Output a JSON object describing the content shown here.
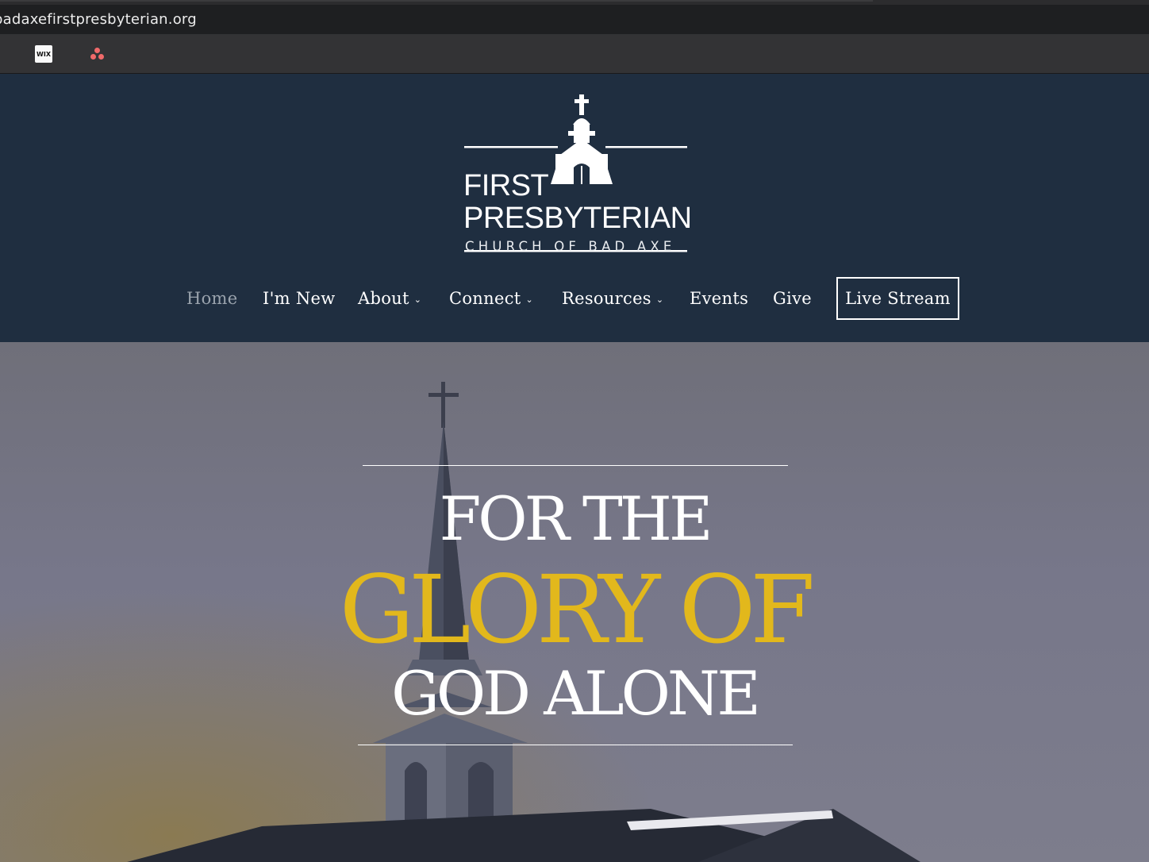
{
  "browser": {
    "url": "badaxefirstpresbyterian.org",
    "bookmarks": [
      {
        "label": "WIX",
        "icon": "wix-icon"
      },
      {
        "label": "",
        "icon": "asana-icon"
      }
    ]
  },
  "logo": {
    "line1": "FIRST",
    "line2": "PRESBYTERIAN",
    "line3": "CHURCH OF BAD AXE"
  },
  "nav": {
    "items": [
      {
        "label": "Home",
        "active": true,
        "dropdown": false
      },
      {
        "label": "I'm New",
        "active": false,
        "dropdown": false
      },
      {
        "label": "About",
        "active": false,
        "dropdown": true
      },
      {
        "label": "Connect",
        "active": false,
        "dropdown": true
      },
      {
        "label": "Resources",
        "active": false,
        "dropdown": true
      },
      {
        "label": "Events",
        "active": false,
        "dropdown": false
      },
      {
        "label": "Give",
        "active": false,
        "dropdown": false
      }
    ],
    "cta": "Live Stream"
  },
  "hero": {
    "line1": "FOR THE",
    "line2": "GLORY OF",
    "line3": "GOD ALONE"
  },
  "colors": {
    "header_bg": "#1f2e40",
    "accent_gold": "#e2b81c",
    "nav_active": "#9aa3ad"
  }
}
